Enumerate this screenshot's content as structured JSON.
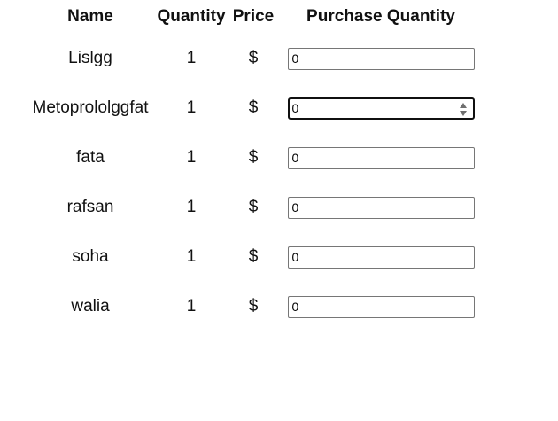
{
  "table": {
    "headers": {
      "name": "Name",
      "quantity": "Quantity",
      "price": "Price",
      "purchase_quantity": "Purchase Quantity"
    },
    "rows": [
      {
        "name": "Lislgg",
        "quantity": "1",
        "price": "$",
        "purchase_value": "0"
      },
      {
        "name": "Metoprololggfat",
        "quantity": "1",
        "price": "$",
        "purchase_value": "0"
      },
      {
        "name": "fata",
        "quantity": "1",
        "price": "$",
        "purchase_value": "0"
      },
      {
        "name": "rafsan",
        "quantity": "1",
        "price": "$",
        "purchase_value": "0"
      },
      {
        "name": "soha",
        "quantity": "1",
        "price": "$",
        "purchase_value": "0"
      },
      {
        "name": "walia",
        "quantity": "1",
        "price": "$",
        "purchase_value": "0"
      }
    ]
  },
  "focused_row": 1,
  "icons": {
    "spinner": "number-spinner-icon"
  }
}
